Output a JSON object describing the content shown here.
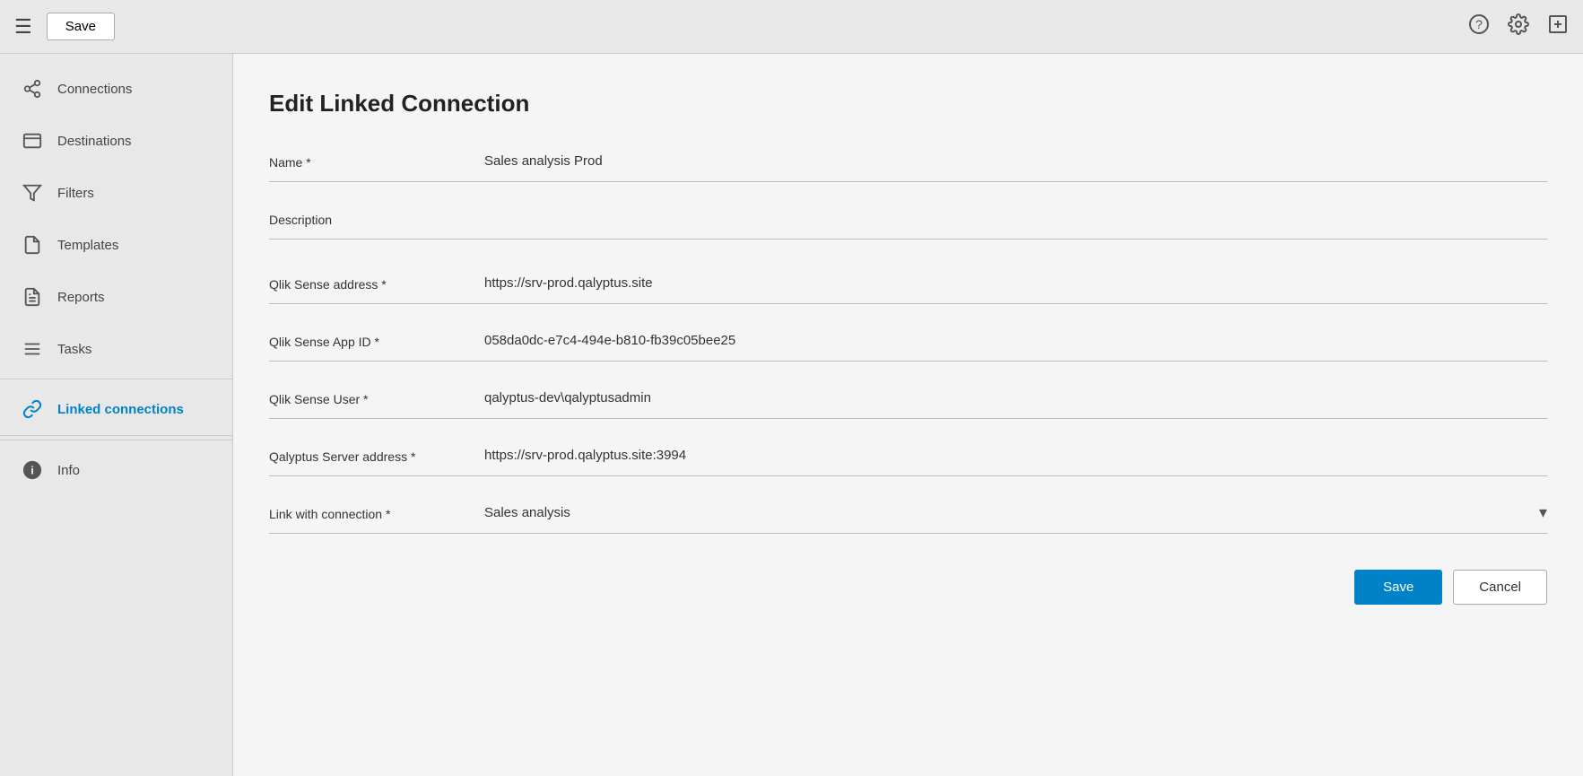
{
  "topbar": {
    "save_label": "Save",
    "hamburger_label": "☰"
  },
  "icons": {
    "help": "?",
    "settings": "⚙",
    "add": "⊞",
    "connections": "⑂",
    "destinations": "▪",
    "filters": "▽",
    "templates": "▪",
    "reports": "▪",
    "tasks": "≡",
    "linked_connections": "⚭",
    "info": "ℹ",
    "dropdown_arrow": "▾"
  },
  "sidebar": {
    "items": [
      {
        "label": "Connections",
        "name": "connections",
        "active": false
      },
      {
        "label": "Destinations",
        "name": "destinations",
        "active": false
      },
      {
        "label": "Filters",
        "name": "filters",
        "active": false
      },
      {
        "label": "Templates",
        "name": "templates",
        "active": false
      },
      {
        "label": "Reports",
        "name": "reports",
        "active": false
      },
      {
        "label": "Tasks",
        "name": "tasks",
        "active": false
      },
      {
        "label": "Linked connections",
        "name": "linked-connections",
        "active": true
      },
      {
        "label": "Info",
        "name": "info",
        "active": false
      }
    ]
  },
  "form": {
    "page_title": "Edit Linked Connection",
    "fields": {
      "name_label": "Name *",
      "name_value": "Sales analysis Prod",
      "description_label": "Description",
      "description_value": "",
      "qlik_sense_address_label": "Qlik Sense address *",
      "qlik_sense_address_value": "https://srv-prod.qalyptus.site",
      "qlik_sense_app_id_label": "Qlik Sense App ID *",
      "qlik_sense_app_id_value": "058da0dc-e7c4-494e-b810-fb39c05bee25",
      "qlik_sense_user_label": "Qlik Sense User *",
      "qlik_sense_user_value": "qalyptus-dev\\qalyptusadmin",
      "qalyptus_server_label": "Qalyptus Server address *",
      "qalyptus_server_value": "https://srv-prod.qalyptus.site:3994",
      "link_with_connection_label": "Link with connection *",
      "link_with_connection_value": "Sales analysis"
    },
    "buttons": {
      "save_label": "Save",
      "cancel_label": "Cancel"
    }
  }
}
